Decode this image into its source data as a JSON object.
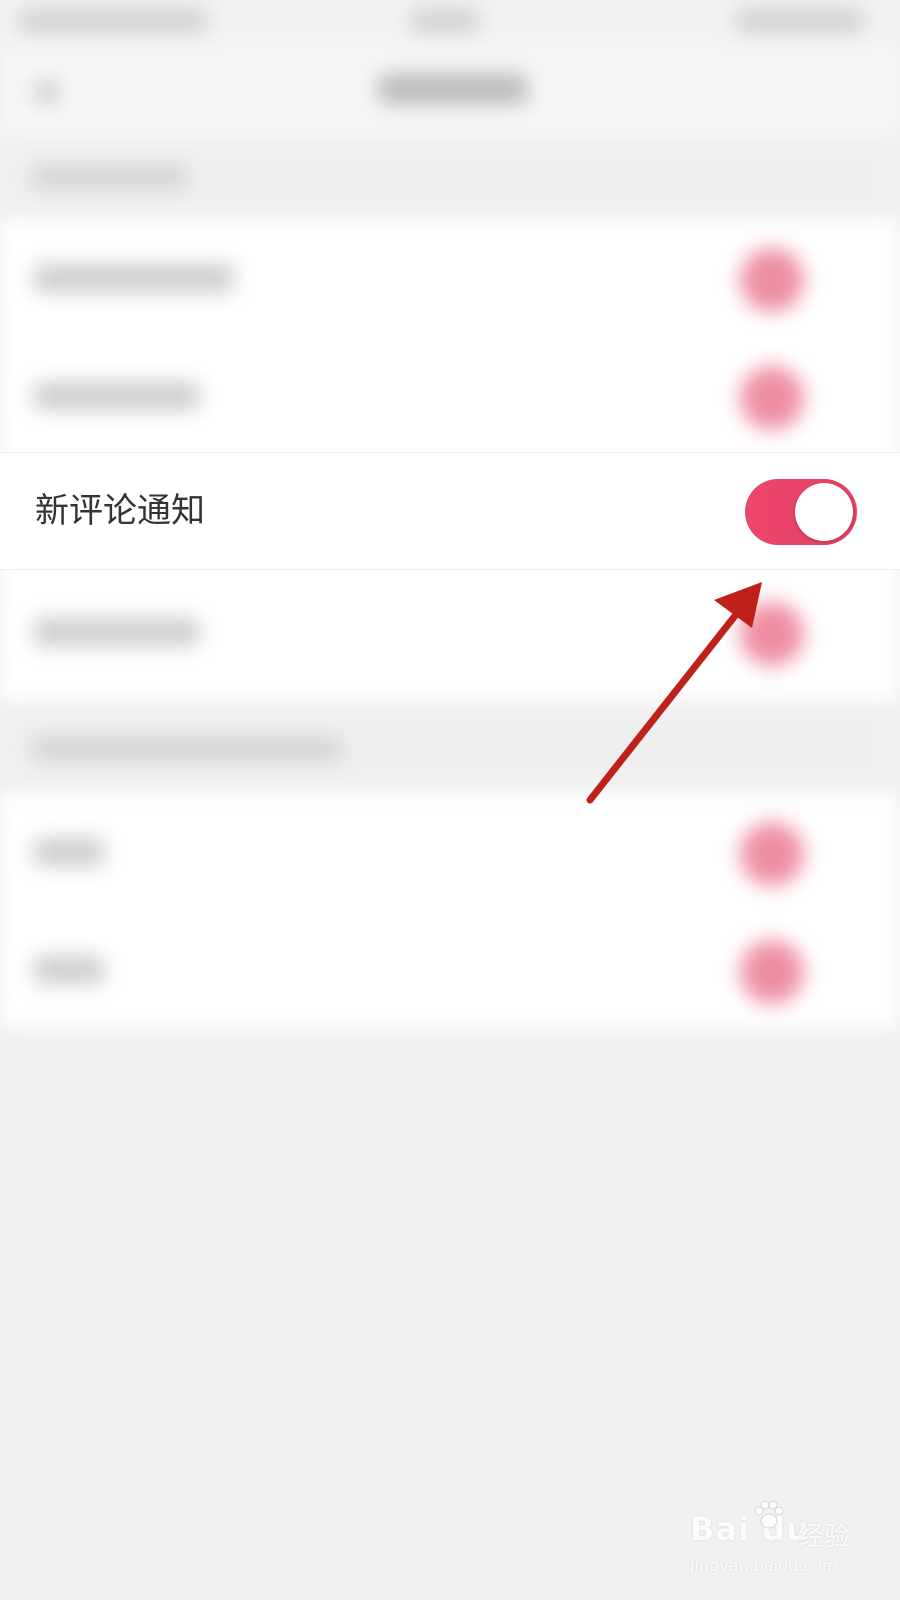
{
  "focused_setting": {
    "label": "新评论通知",
    "toggle_on": true
  },
  "colors": {
    "toggle_on": "#ea4466",
    "arrow": "#c0201a",
    "background": "#f1f1f1"
  },
  "watermark": {
    "brand": "Bai du",
    "suffix": "经验",
    "url": "jingyan.baidu.com"
  }
}
